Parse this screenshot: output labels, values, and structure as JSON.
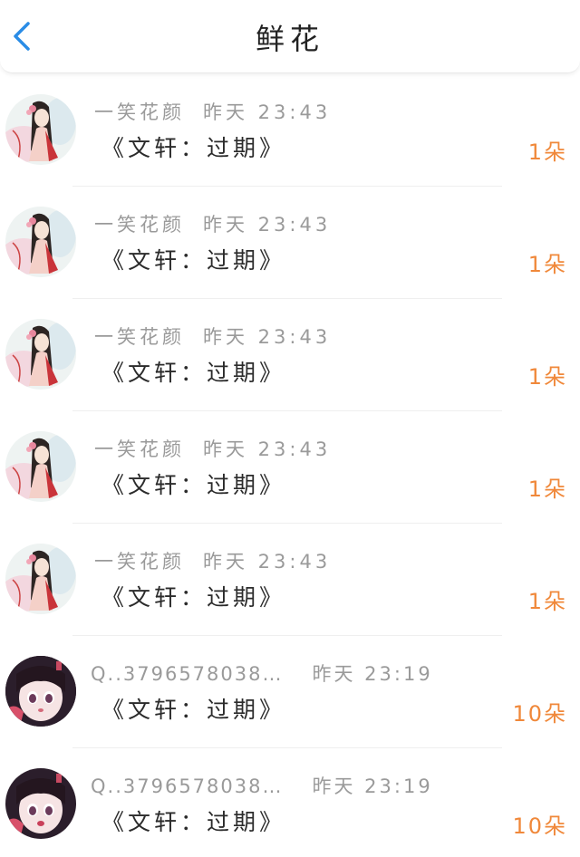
{
  "header": {
    "title": "鲜花",
    "back_icon": "chevron-left-icon",
    "accent": "#2a8ce6"
  },
  "colors": {
    "amount": "#f0883a",
    "meta": "#9a9a9a",
    "message": "#2b2b2b"
  },
  "rows": [
    {
      "user": "一笑花颜",
      "time": "昨天 23:43",
      "message": "《文轩：过期》",
      "amount": "1朵",
      "avatar": "anime-girl-avatar"
    },
    {
      "user": "一笑花颜",
      "time": "昨天 23:43",
      "message": "《文轩：过期》",
      "amount": "1朵",
      "avatar": "anime-girl-avatar"
    },
    {
      "user": "一笑花颜",
      "time": "昨天 23:43",
      "message": "《文轩：过期》",
      "amount": "1朵",
      "avatar": "anime-girl-avatar"
    },
    {
      "user": "一笑花颜",
      "time": "昨天 23:43",
      "message": "《文轩：过期》",
      "amount": "1朵",
      "avatar": "anime-girl-avatar"
    },
    {
      "user": "一笑花颜",
      "time": "昨天 23:43",
      "message": "《文轩：过期》",
      "amount": "1朵",
      "avatar": "anime-girl-avatar"
    },
    {
      "user": "Q..3796578038…",
      "time": "昨天 23:19",
      "message": "《文轩：过期》",
      "amount": "10朵",
      "avatar": "dark-hair-girl-avatar"
    },
    {
      "user": "Q..3796578038…",
      "time": "昨天 23:19",
      "message": "《文轩：过期》",
      "amount": "10朵",
      "avatar": "dark-hair-girl-avatar"
    }
  ]
}
